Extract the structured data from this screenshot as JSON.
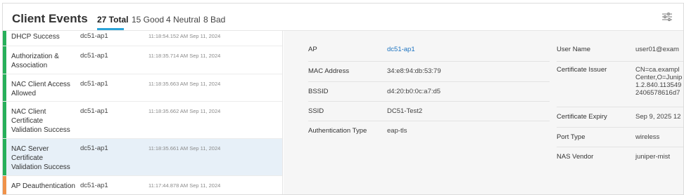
{
  "header": {
    "title": "Client Events",
    "tabs": [
      "27 Total",
      "15 Good",
      "4 Neutral",
      "8 Bad"
    ],
    "settings_icon": "sliders-icon"
  },
  "colors": {
    "good": "#27b05a",
    "bad": "#f0924a",
    "accent": "#2aa3d8",
    "selected_row": "#e7f0f8"
  },
  "events": [
    {
      "title": "DHCP Success",
      "ap": "dc51-ap1",
      "time": "11:18:54.152 AM Sep 11, 2024",
      "status": "good"
    },
    {
      "title": "Authorization & Association",
      "ap": "dc51-ap1",
      "time": "11:18:35.714 AM Sep 11, 2024",
      "status": "good"
    },
    {
      "title": "NAC Client Access Allowed",
      "ap": "dc51-ap1",
      "time": "11:18:35.663 AM Sep 11, 2024",
      "status": "good"
    },
    {
      "title": "NAC Client Certificate Validation Success",
      "ap": "dc51-ap1",
      "time": "11:18:35.662 AM Sep 11, 2024",
      "status": "good"
    },
    {
      "title": "NAC Server Certificate Validation Success",
      "ap": "dc51-ap1",
      "time": "11:18:35.661 AM Sep 11, 2024",
      "status": "good",
      "selected": true
    },
    {
      "title": "AP Deauthentication",
      "ap": "dc51-ap1",
      "time": "11:17:44.878 AM Sep 11, 2024",
      "status": "bad"
    }
  ],
  "details_left": [
    {
      "label": "AP",
      "value": "dc51-ap1"
    },
    {
      "label": "MAC Address",
      "value": "34:e8:94:db:53:79"
    },
    {
      "label": "BSSID",
      "value": "d4:20:b0:0c:a7:d5"
    },
    {
      "label": "SSID",
      "value": "DC51-Test2"
    },
    {
      "label": "Authentication Type",
      "value": "eap-tls"
    }
  ],
  "details_right": [
    {
      "label": "User Name",
      "value": "user01@exam"
    },
    {
      "label": "Certificate Issuer",
      "value": "CN=ca.exampl Center,O=Junip 1.2.840.113549 2406578616d7"
    },
    {
      "label": "Certificate Expiry",
      "value": "Sep 9, 2025 12"
    },
    {
      "label": "Port Type",
      "value": "wireless"
    },
    {
      "label": "NAS Vendor",
      "value": "juniper-mist"
    }
  ]
}
